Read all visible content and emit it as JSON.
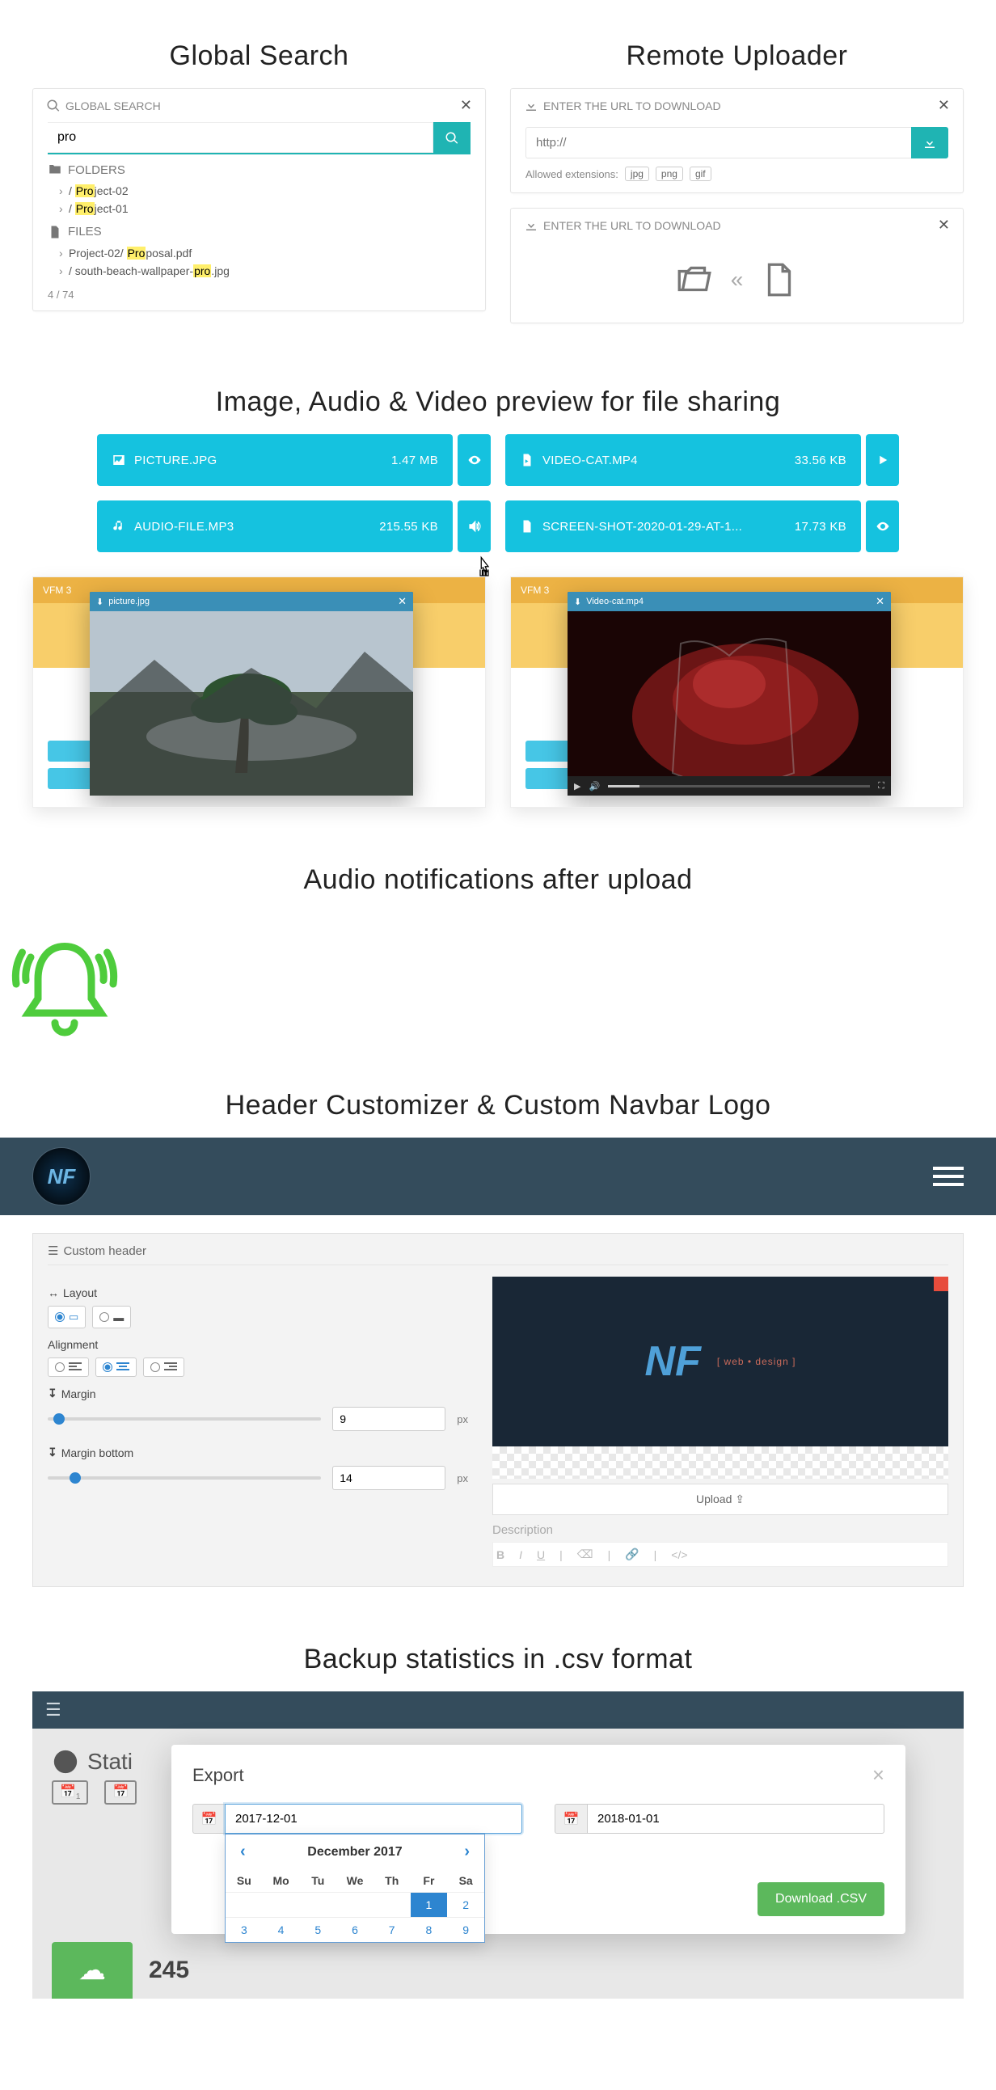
{
  "titles": {
    "global_search": "Global Search",
    "remote_uploader": "Remote Uploader",
    "preview": "Image, Audio & Video preview for file sharing",
    "audio_notif": "Audio notifications after upload",
    "header_custom": "Header Customizer & Custom Navbar Logo",
    "backup": "Backup statistics in .csv format"
  },
  "search": {
    "panel_title": "GLOBAL SEARCH",
    "value": "pro",
    "folders_label": "FOLDERS",
    "files_label": "FILES",
    "folders": [
      {
        "prefix": " / ",
        "hl": "Pro",
        "rest": "ject-02"
      },
      {
        "prefix": " / ",
        "hl": "Pro",
        "rest": "ject-01"
      }
    ],
    "files": [
      {
        "prefix": "Project-02/ ",
        "hl": "Pro",
        "rest": "posal.pdf"
      },
      {
        "prefix": " / south-beach-wallpaper-",
        "hl": "pro",
        "rest": ".jpg"
      }
    ],
    "count": "4 / 74"
  },
  "remote": {
    "panel_title": "ENTER THE URL TO DOWNLOAD",
    "placeholder": "http://",
    "allowed_label": "Allowed extensions:",
    "ext": [
      "jpg",
      "png",
      "gif"
    ]
  },
  "files": [
    {
      "icon": "image",
      "name": "PICTURE.JPG",
      "size": "1.47 MB",
      "action": "eye"
    },
    {
      "icon": "video",
      "name": "VIDEO-CAT.MP4",
      "size": "33.56 KB",
      "action": "play"
    },
    {
      "icon": "audio",
      "name": "AUDIO-FILE.MP3",
      "size": "215.55 KB",
      "action": "volume"
    },
    {
      "icon": "image",
      "name": "SCREEN-SHOT-2020-01-29-AT-1...",
      "size": "17.73 KB",
      "action": "eye"
    }
  ],
  "overlays": {
    "left_title": "picture.jpg",
    "right_title": "Video-cat.mp4",
    "brand": "VFM 3"
  },
  "customizer": {
    "panel_title": "Custom header",
    "layout_label": "Layout",
    "alignment_label": "Alignment",
    "margin_label": "Margin",
    "margin_bottom_label": "Margin bottom",
    "margin_val": "9",
    "margin_bottom_val": "14",
    "unit": "px",
    "upload_label": "Upload ",
    "desc_label": "Description",
    "banner_sub": "[ web • design ]"
  },
  "backup": {
    "stats_label": "Stati",
    "modal_title": "Export",
    "date_from": "2017-12-01",
    "date_to": "2018-01-01",
    "dl_label": "Download .CSV",
    "cal_title": "December 2017",
    "dow": [
      "Su",
      "Mo",
      "Tu",
      "We",
      "Th",
      "Fr",
      "Sa"
    ],
    "weeks": [
      [
        "",
        "",
        "",
        "",
        "",
        "1",
        "2"
      ],
      [
        "3",
        "4",
        "5",
        "6",
        "7",
        "8",
        "9"
      ]
    ],
    "selected": "1",
    "bg_number": "245"
  }
}
